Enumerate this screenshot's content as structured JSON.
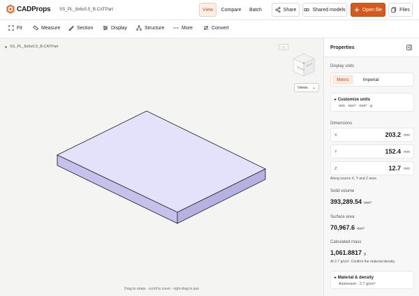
{
  "app": {
    "name": "CADProps",
    "file_name": "SS_PL_8x6x0.5_B.CATPart",
    "colors": {
      "accent": "#d35a1f",
      "plate_face": "#e4e2fa",
      "plate_side": "#c4c1ea"
    }
  },
  "topnav": {
    "view": "View",
    "compare": "Compare",
    "batch": "Batch",
    "share": "Share",
    "shared_models": "Shared models",
    "open_file": "Open file",
    "files": "Files",
    "active_tab": "View"
  },
  "toolbar": {
    "fit": "Fit",
    "measure": "Measure",
    "section": "Section",
    "display": "Display",
    "structure": "Structure",
    "more": "More",
    "convert": "Convert"
  },
  "viewport": {
    "file_label": "SS_PL_8x6x0.5_B.CATPart",
    "views_select": "Views",
    "hint": "Drag to rotate · scroll to zoom · right-drag to pan",
    "view_cube_icon": "view-cube-icon"
  },
  "properties": {
    "title": "Properties",
    "display_units_label": "Display units",
    "metric": "Metric",
    "imperial": "Imperial",
    "selected_units": "Metric",
    "customize_units_title": "Customize units",
    "customize_units_value": "mm · mm² · mm³ · g",
    "dimensions_label": "Dimensions",
    "dimensions": [
      {
        "axis": "X",
        "value": "203.2",
        "unit": "mm"
      },
      {
        "axis": "Y",
        "value": "152.4",
        "unit": "mm"
      },
      {
        "axis": "Z",
        "value": "12.7",
        "unit": "mm"
      }
    ],
    "dimensions_note": "Along source X, Y and Z axes",
    "solid_volume_label": "Solid volume",
    "solid_volume_value": "393,289.54",
    "solid_volume_unit": "mm³",
    "surface_area_label": "Surface area",
    "surface_area_value": "70,967.6",
    "surface_area_unit": "mm²",
    "mass_label": "Calculated mass",
    "mass_value": "1,061.8817",
    "mass_unit": "g",
    "mass_note": "At 2.7 g/cm³. Confirm the material density.",
    "material_title": "Material & density",
    "material_value": "Aluminium · 2.7 g/cm³"
  }
}
